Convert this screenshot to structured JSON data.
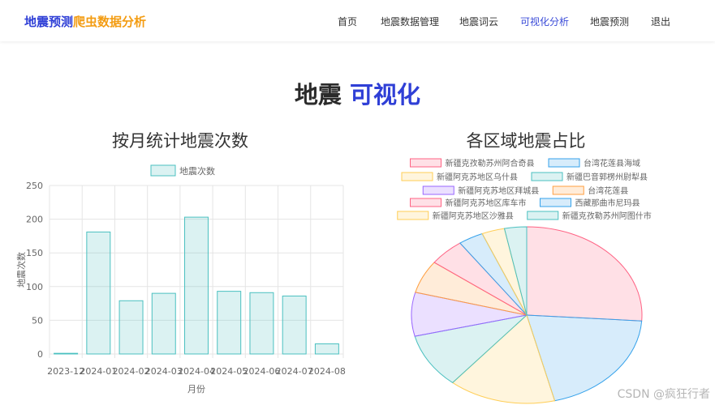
{
  "navbar": {
    "brand_part1": "地震预测",
    "brand_part2": "爬虫数据分析",
    "items": [
      {
        "label": "首页",
        "active": false
      },
      {
        "label": "地震数据管理",
        "active": false
      },
      {
        "label": "地震词云",
        "active": false
      },
      {
        "label": "可视化分析",
        "active": true
      },
      {
        "label": "地震预测",
        "active": false
      },
      {
        "label": "退出",
        "active": false
      }
    ]
  },
  "page": {
    "title_part1": "地震",
    "title_part2": "可视化"
  },
  "bar_chart": {
    "title": "按月统计地震次数"
  },
  "pie_chart": {
    "title": "各区域地震占比"
  },
  "watermark": "CSDN @疯狂行者",
  "chart_data": [
    {
      "type": "bar",
      "title": "按月统计地震次数",
      "xlabel": "月份",
      "ylabel": "地震次数",
      "legend": [
        "地震次数"
      ],
      "legend_position": "top-center",
      "categories": [
        "2023-12",
        "2024-01",
        "2024-02",
        "2024-03",
        "2024-04",
        "2024-05",
        "2024-06",
        "2024-07",
        "2024-08"
      ],
      "series": [
        {
          "name": "地震次数",
          "values": [
            1,
            181,
            79,
            90,
            203,
            93,
            91,
            86,
            15
          ]
        }
      ],
      "ylim": [
        0,
        250
      ],
      "yticks": [
        0,
        50,
        100,
        150,
        200,
        250
      ],
      "grid": true,
      "color": "#4bc0c0"
    },
    {
      "type": "pie",
      "title": "各区域地震占比",
      "legend_position": "top-center",
      "labels": [
        "新疆克孜勒苏州阿合奇县",
        "台湾花莲县海域",
        "新疆阿克苏地区乌什县",
        "新疆巴音郭楞州尉犁县",
        "新疆阿克苏地区拜城县",
        "台湾花莲县",
        "新疆阿克苏地区库车市",
        "西藏那曲市尼玛县",
        "新疆阿克苏地区沙雅县",
        "新疆克孜勒苏州阿图什市"
      ],
      "values": [
        26,
        20,
        15,
        10,
        8,
        6,
        5,
        3.5,
        3.2,
        3.1
      ],
      "colors": [
        "#ff6384",
        "#36a2eb",
        "#ffce56",
        "#4bc0c0",
        "#9966ff",
        "#ff9f40",
        "#ff6384",
        "#36a2eb",
        "#ffce56",
        "#4bc0c0"
      ]
    }
  ]
}
